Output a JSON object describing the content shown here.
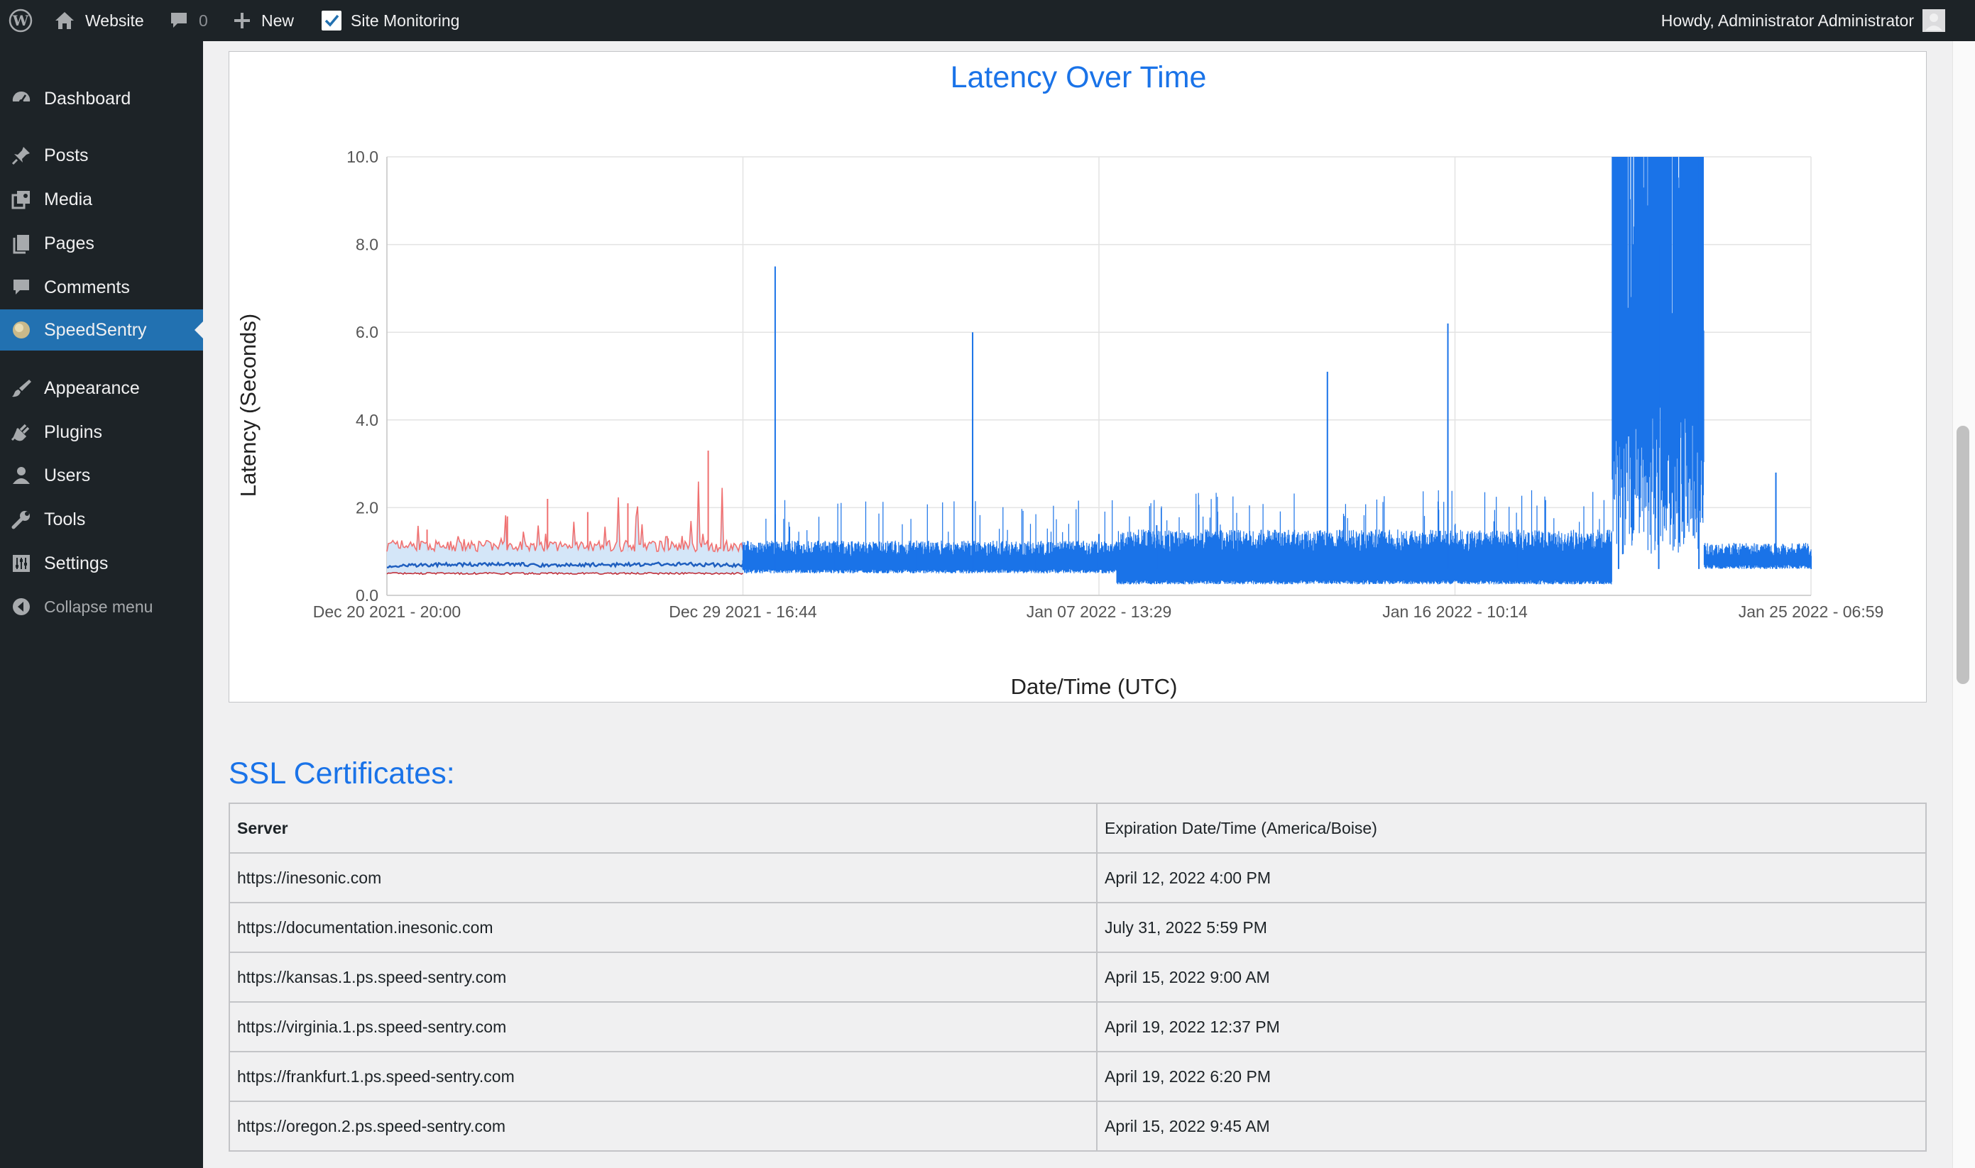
{
  "adminbar": {
    "site_name": "Website",
    "comments_count": "0",
    "new_label": "New",
    "plugin_label": "Site Monitoring",
    "greeting": "Howdy, Administrator Administrator"
  },
  "sidebar": {
    "items": [
      {
        "label": "Dashboard",
        "icon": "dashboard-icon"
      },
      {
        "label": "Posts",
        "icon": "pin-icon"
      },
      {
        "label": "Media",
        "icon": "media-icon"
      },
      {
        "label": "Pages",
        "icon": "pages-icon"
      },
      {
        "label": "Comments",
        "icon": "comment-icon"
      },
      {
        "label": "SpeedSentry",
        "icon": "speedsentry-icon",
        "current": true
      },
      {
        "label": "Appearance",
        "icon": "brush-icon"
      },
      {
        "label": "Plugins",
        "icon": "plug-icon"
      },
      {
        "label": "Users",
        "icon": "user-icon"
      },
      {
        "label": "Tools",
        "icon": "wrench-icon"
      },
      {
        "label": "Settings",
        "icon": "settings-icon"
      }
    ],
    "collapse_label": "Collapse menu"
  },
  "chart_data": {
    "type": "line",
    "title": "Latency Over Time",
    "xlabel": "Date/Time (UTC)",
    "ylabel": "Latency (Seconds)",
    "ylim": [
      0,
      10
    ],
    "yticks": [
      "0.0",
      "2.0",
      "4.0",
      "6.0",
      "8.0",
      "10.0"
    ],
    "xticks": [
      "Dec 20 2021 - 20:00",
      "Dec 29 2021 - 16:44",
      "Jan 07 2022 - 13:29",
      "Jan 16 2022 - 10:14",
      "Jan 25 2022 - 06:59"
    ],
    "grid": true,
    "colors": {
      "latency": "#1a73e8",
      "max": "#f07070",
      "min": "#c0303a",
      "band": "#cfe3f7",
      "avg": "#1f5fbf"
    },
    "series": [
      {
        "key": "max",
        "x": [
          "2021-12-20T20:00",
          "2021-12-21T20:00",
          "2021-12-22T20:00",
          "2021-12-23T20:00",
          "2021-12-24T20:00",
          "2021-12-25T20:00",
          "2021-12-26T20:00",
          "2021-12-27T20:00",
          "2021-12-28T20:00",
          "2021-12-29T16:44"
        ],
        "values": [
          1.0,
          1.5,
          1.1,
          1.8,
          2.2,
          1.9,
          2.1,
          1.3,
          3.3,
          1.0
        ]
      },
      {
        "key": "avg",
        "x": [
          "2021-12-20T20:00",
          "2021-12-21T20:00",
          "2021-12-22T20:00",
          "2021-12-23T20:00",
          "2021-12-24T20:00",
          "2021-12-25T20:00",
          "2021-12-26T20:00",
          "2021-12-27T20:00",
          "2021-12-28T20:00",
          "2021-12-29T16:44"
        ],
        "values": [
          0.65,
          0.7,
          0.7,
          0.72,
          0.68,
          0.7,
          0.7,
          0.72,
          0.7,
          0.68
        ]
      },
      {
        "key": "min",
        "x": [
          "2021-12-20T20:00",
          "2021-12-29T16:44"
        ],
        "values": [
          0.5,
          0.5
        ]
      },
      {
        "key": "latency",
        "x": [
          "2021-12-29T16:44",
          "2021-12-30T12:00",
          "2022-01-01T00:00",
          "2022-01-03T00:00",
          "2022-01-04T10:00",
          "2022-01-06T00:00",
          "2022-01-07T13:29",
          "2022-01-09T00:00",
          "2022-01-11T00:00",
          "2022-01-13T06:00",
          "2022-01-16T06:00",
          "2022-01-18T00:00",
          "2022-01-20T12:00",
          "2022-01-21T12:00",
          "2022-01-22T12:00",
          "2022-01-24T10:00",
          "2022-01-25T06:59"
        ],
        "values": [
          0.8,
          7.5,
          1.2,
          1.1,
          6.0,
          1.0,
          1.4,
          1.6,
          1.3,
          5.1,
          6.2,
          1.5,
          10.0,
          8.0,
          10.0,
          2.8,
          0.9
        ]
      }
    ]
  },
  "ssl": {
    "title": "SSL Certificates:",
    "headers": [
      "Server",
      "Expiration Date/Time (America/Boise)"
    ],
    "rows": [
      [
        "https://inesonic.com",
        "April 12, 2022 4:00 PM"
      ],
      [
        "https://documentation.inesonic.com",
        "July 31, 2022 5:59 PM"
      ],
      [
        "https://kansas.1.ps.speed-sentry.com",
        "April 15, 2022 9:00 AM"
      ],
      [
        "https://virginia.1.ps.speed-sentry.com",
        "April 19, 2022 12:37 PM"
      ],
      [
        "https://frankfurt.1.ps.speed-sentry.com",
        "April 19, 2022 6:20 PM"
      ],
      [
        "https://oregon.2.ps.speed-sentry.com",
        "April 15, 2022 9:45 AM"
      ]
    ]
  }
}
